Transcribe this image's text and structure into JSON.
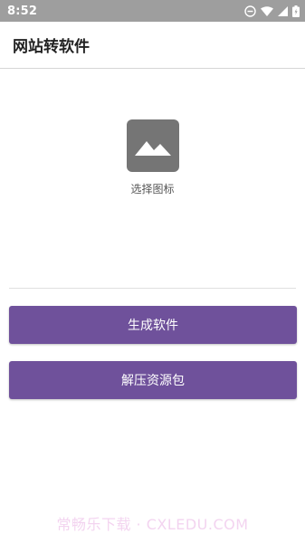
{
  "status_bar": {
    "time": "8:52",
    "icons": [
      "do-not-disturb-icon",
      "wifi-icon",
      "cell-signal-icon",
      "battery-icon"
    ]
  },
  "app_bar": {
    "title": "网站转软件"
  },
  "icon_picker": {
    "icon": "image-placeholder-icon",
    "label": "选择图标"
  },
  "buttons": {
    "generate_label": "生成软件",
    "extract_label": "解压资源包"
  },
  "watermark": {
    "text": "常畅乐下载 · CXLEDU.COM"
  },
  "colors": {
    "status_bar_bg": "#9e9e9e",
    "button_bg": "#6f519b",
    "icon_bg": "#757575"
  }
}
